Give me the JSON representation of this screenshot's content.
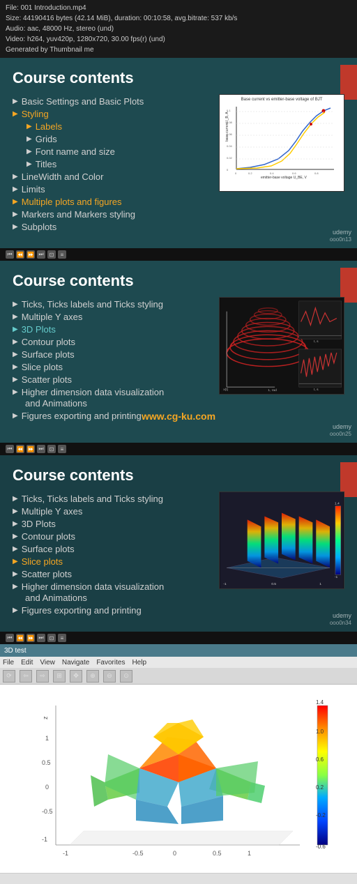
{
  "infobar": {
    "line1": "File: 001 Introduction.mp4",
    "line2": "Size: 44190416 bytes (42.14 MiB), duration: 00:10:58, avg.bitrate: 537 kb/s",
    "line3": "Audio: aac, 48000 Hz, stereo (und)",
    "line4": "Video: h264, yuv420p, 1280x720, 30.00 fps(r) (und)",
    "line5": "Generated by Thumbnail me"
  },
  "section1": {
    "title": "Course contents",
    "items": [
      {
        "label": "Basic Settings and Basic Plots",
        "highlighted": false,
        "sub": false
      },
      {
        "label": "Styling",
        "highlighted": true,
        "sub": false
      },
      {
        "label": "Labels",
        "highlighted": true,
        "sub": true
      },
      {
        "label": "Grids",
        "highlighted": false,
        "sub": true
      },
      {
        "label": "Font name and size",
        "highlighted": false,
        "sub": true
      },
      {
        "label": "Titles",
        "highlighted": false,
        "sub": true
      },
      {
        "label": "LineWidth and Color",
        "highlighted": false,
        "sub": false
      },
      {
        "label": "Limits",
        "highlighted": false,
        "sub": false
      },
      {
        "label": "Multiple plots and figures",
        "highlighted": true,
        "sub": false
      },
      {
        "label": "Markers and Markers styling",
        "highlighted": false,
        "sub": false
      },
      {
        "label": "Subplots",
        "highlighted": false,
        "sub": false
      }
    ],
    "chart_title": "Base current vs emitter-base voltage of BJT",
    "udemy": "udemy",
    "udemy_num": "ooo0n13"
  },
  "section2": {
    "title": "Course contents",
    "items": [
      {
        "label": "Ticks, Ticks labels and Ticks styling",
        "highlighted": false,
        "sub": false
      },
      {
        "label": "Multiple Y axes",
        "highlighted": false,
        "sub": false
      },
      {
        "label": "3D Plots",
        "highlighted": true,
        "sub": false
      },
      {
        "label": "Contour plots",
        "highlighted": false,
        "sub": false
      },
      {
        "label": "Surface plots",
        "highlighted": false,
        "sub": false
      },
      {
        "label": "Slice plots",
        "highlighted": false,
        "sub": false
      },
      {
        "label": "Scatter plots",
        "highlighted": false,
        "sub": false
      },
      {
        "label": "Higher dimension data visualization",
        "highlighted": false,
        "sub": false
      },
      {
        "label": "and Animations",
        "highlighted": false,
        "sub": false
      },
      {
        "label": "Figures exporting and printing",
        "highlighted": false,
        "sub": false
      }
    ],
    "watermark": "www.cg-ku.com",
    "udemy": "udemy",
    "udemy_num": "ooo0n25"
  },
  "section3": {
    "title": "Course contents",
    "items": [
      {
        "label": "Ticks, Ticks labels and Ticks styling",
        "highlighted": false,
        "sub": false
      },
      {
        "label": "Multiple Y axes",
        "highlighted": false,
        "sub": false
      },
      {
        "label": "3D Plots",
        "highlighted": false,
        "sub": false
      },
      {
        "label": "Contour plots",
        "highlighted": false,
        "sub": false
      },
      {
        "label": "Surface plots",
        "highlighted": false,
        "sub": false
      },
      {
        "label": "Slice plots",
        "highlighted": true,
        "sub": false
      },
      {
        "label": "Scatter plots",
        "highlighted": false,
        "sub": false
      },
      {
        "label": "Higher dimension data visualization",
        "highlighted": false,
        "sub": false
      },
      {
        "label": "and Animations",
        "highlighted": false,
        "sub": false
      },
      {
        "label": "Figures exporting and printing",
        "highlighted": false,
        "sub": false
      }
    ],
    "udemy": "udemy",
    "udemy_num": "ooo0n34"
  },
  "bottom_window": {
    "title": "3D test",
    "menu_items": [
      "File",
      "Edit",
      "View",
      "Navigate",
      "Favorites",
      "Help"
    ],
    "statusbar": ""
  },
  "footer_sections": [
    {
      "icons": [
        "◉",
        "◉",
        "◉",
        "◉",
        "◉",
        "◉"
      ]
    },
    {
      "icons": [
        "◉",
        "◉",
        "◉",
        "◉",
        "◉",
        "◉"
      ]
    },
    {
      "icons": [
        "◉",
        "◉",
        "◉",
        "◉",
        "◉",
        "◉"
      ]
    }
  ]
}
